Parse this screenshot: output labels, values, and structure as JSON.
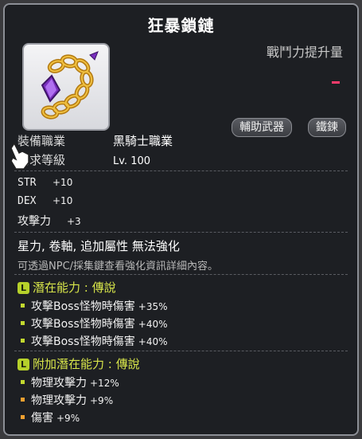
{
  "item": {
    "name": "狂暴鎖鏈",
    "combat_power_label": "戰鬥力提升量",
    "tags": [
      "輔助武器",
      "鐵鍊"
    ]
  },
  "requirements": {
    "job_label": "裝備職業",
    "job_value": "黑騎士職業",
    "level_label": "需求等級",
    "level_value": "Lv. 100"
  },
  "stats": [
    {
      "name": "STR",
      "value": "+10"
    },
    {
      "name": "DEX",
      "value": "+10"
    },
    {
      "name": "攻擊力",
      "value": "+3"
    }
  ],
  "notes": {
    "line1": "星力, 卷軸, 追加屬性 無法強化",
    "line2": "可透過NPC/採集鍵查看強化資訊詳細內容。"
  },
  "potential": {
    "badge": "L",
    "title": "潛在能力 : 傳說",
    "lines": [
      {
        "text": "攻擊Boss怪物時傷害",
        "value": "+35%"
      },
      {
        "text": "攻擊Boss怪物時傷害",
        "value": "+40%"
      },
      {
        "text": "攻擊Boss怪物時傷害",
        "value": "+40%"
      }
    ]
  },
  "additional_potential": {
    "badge": "L",
    "title": "附加潛在能力 : 傳說",
    "lines": [
      {
        "text": "物理攻擊力",
        "value": "+12%",
        "dot": "green"
      },
      {
        "text": "物理攻擊力",
        "value": "+9%",
        "dot": "orange"
      },
      {
        "text": "傷害",
        "value": "+9%",
        "dot": "orange"
      }
    ]
  },
  "colors": {
    "potential_title": "#d8e64a",
    "legend_badge": "#b6d12a",
    "cp_indicator": "#ff3b6b"
  }
}
